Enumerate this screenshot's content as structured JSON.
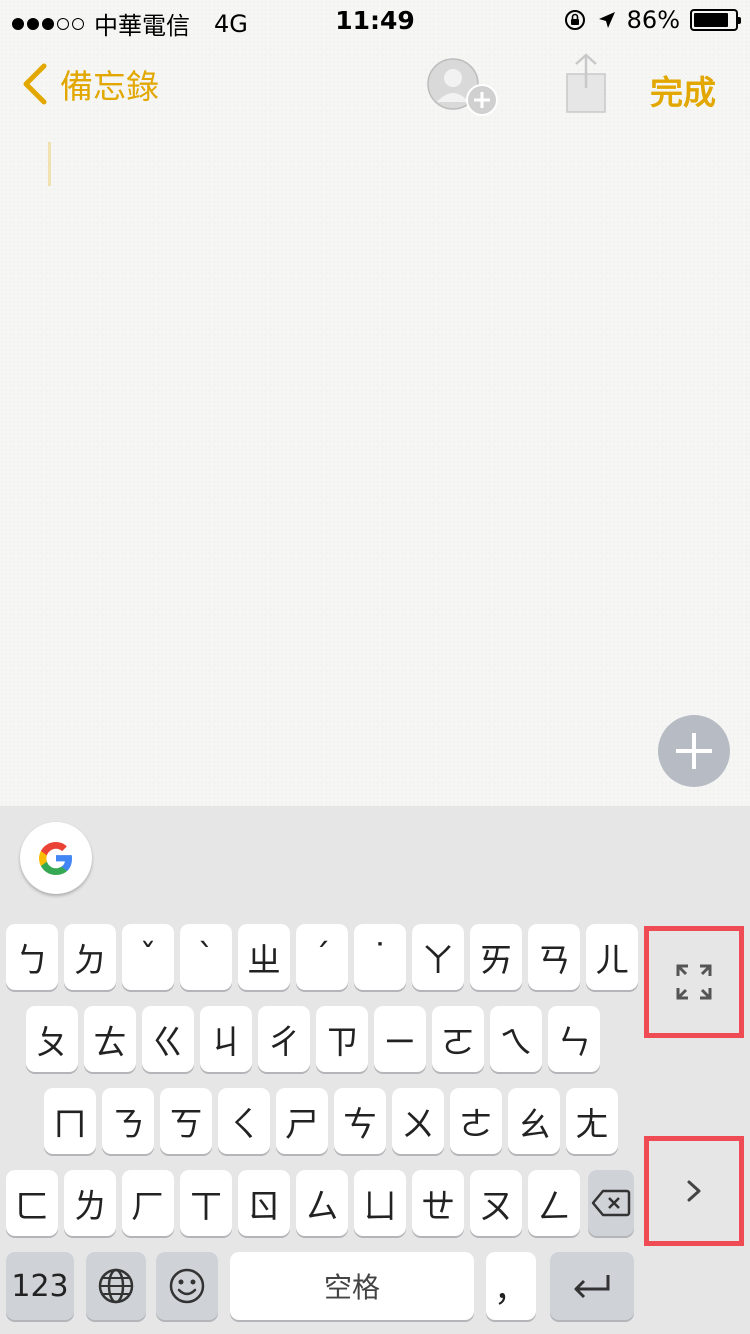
{
  "status_bar": {
    "carrier": "中華電信",
    "network": "4G",
    "time": "11:49",
    "battery": "86%",
    "battery_level": 0.86,
    "signal_dots_on": 3,
    "signal_dots_total": 5
  },
  "nav": {
    "back_label": "備忘錄",
    "done_label": "完成",
    "accent_color": "#e2a700"
  },
  "keyboard": {
    "rows": [
      [
        "ㄅ",
        "ㄉ",
        "ˇ",
        "ˋ",
        "ㄓ",
        "ˊ",
        "˙",
        "ㄚ",
        "ㄞ",
        "ㄢ",
        "ㄦ"
      ],
      [
        "ㄆ",
        "ㄊ",
        "ㄍ",
        "ㄐ",
        "ㄔ",
        "ㄗ",
        "ㄧ",
        "ㄛ",
        "ㄟ",
        "ㄣ"
      ],
      [
        "ㄇ",
        "ㄋ",
        "ㄎ",
        "ㄑ",
        "ㄕ",
        "ㄘ",
        "ㄨ",
        "ㄜ",
        "ㄠ",
        "ㄤ"
      ],
      [
        "ㄈ",
        "ㄌ",
        "ㄏ",
        "ㄒ",
        "ㄖ",
        "ㄙ",
        "ㄩ",
        "ㄝ",
        "ㄡ",
        "ㄥ"
      ]
    ],
    "numbers_label": "123",
    "space_label": "空格",
    "comma_label": "，",
    "highlight_color": "#ef4b55"
  }
}
